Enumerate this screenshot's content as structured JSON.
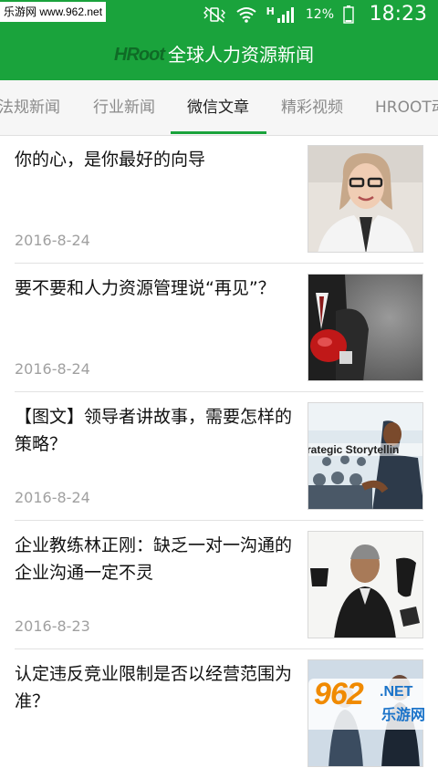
{
  "watermark_top": "乐游网 www.962.net",
  "status": {
    "signal_letter": "H",
    "battery_percent": "12%",
    "time": "18:23"
  },
  "header": {
    "logo": "HRoot",
    "title": "全球人力资源新闻"
  },
  "tabs": [
    {
      "label": "法规新闻",
      "active": false
    },
    {
      "label": "行业新闻",
      "active": false
    },
    {
      "label": "微信文章",
      "active": true
    },
    {
      "label": "精彩视频",
      "active": false
    },
    {
      "label": "HROOT动",
      "active": false
    }
  ],
  "articles": [
    {
      "title": "你的心，是你最好的向导",
      "date": "2016-8-24",
      "thumb": "woman-glasses-portrait"
    },
    {
      "title": "要不要和人力资源管理说“再见”？",
      "date": "2016-8-24",
      "thumb": "boxing-glove-businessman"
    },
    {
      "title": "【图文】领导者讲故事，需要怎样的策略？",
      "date": "2016-8-24",
      "thumb": "strategic-storytelling-audience"
    },
    {
      "title": "企业教练林正刚：缺乏一对一沟通的企业沟通一定不灵",
      "date": "2016-8-23",
      "thumb": "coach-portrait-calligraphy"
    },
    {
      "title": "认定违反竞业限制是否以经营范围为准？",
      "date": "",
      "thumb": "people-photo"
    }
  ],
  "thumb_texts": {
    "storytelling": "rategic Storytellin"
  },
  "corner_watermark": {
    "big": "962",
    "net": ".NET",
    "cn": "乐游网"
  },
  "colors": {
    "primary_green": "#1aa33c",
    "date_gray": "#a0a0a0",
    "tab_inactive": "#8a8a8a"
  }
}
